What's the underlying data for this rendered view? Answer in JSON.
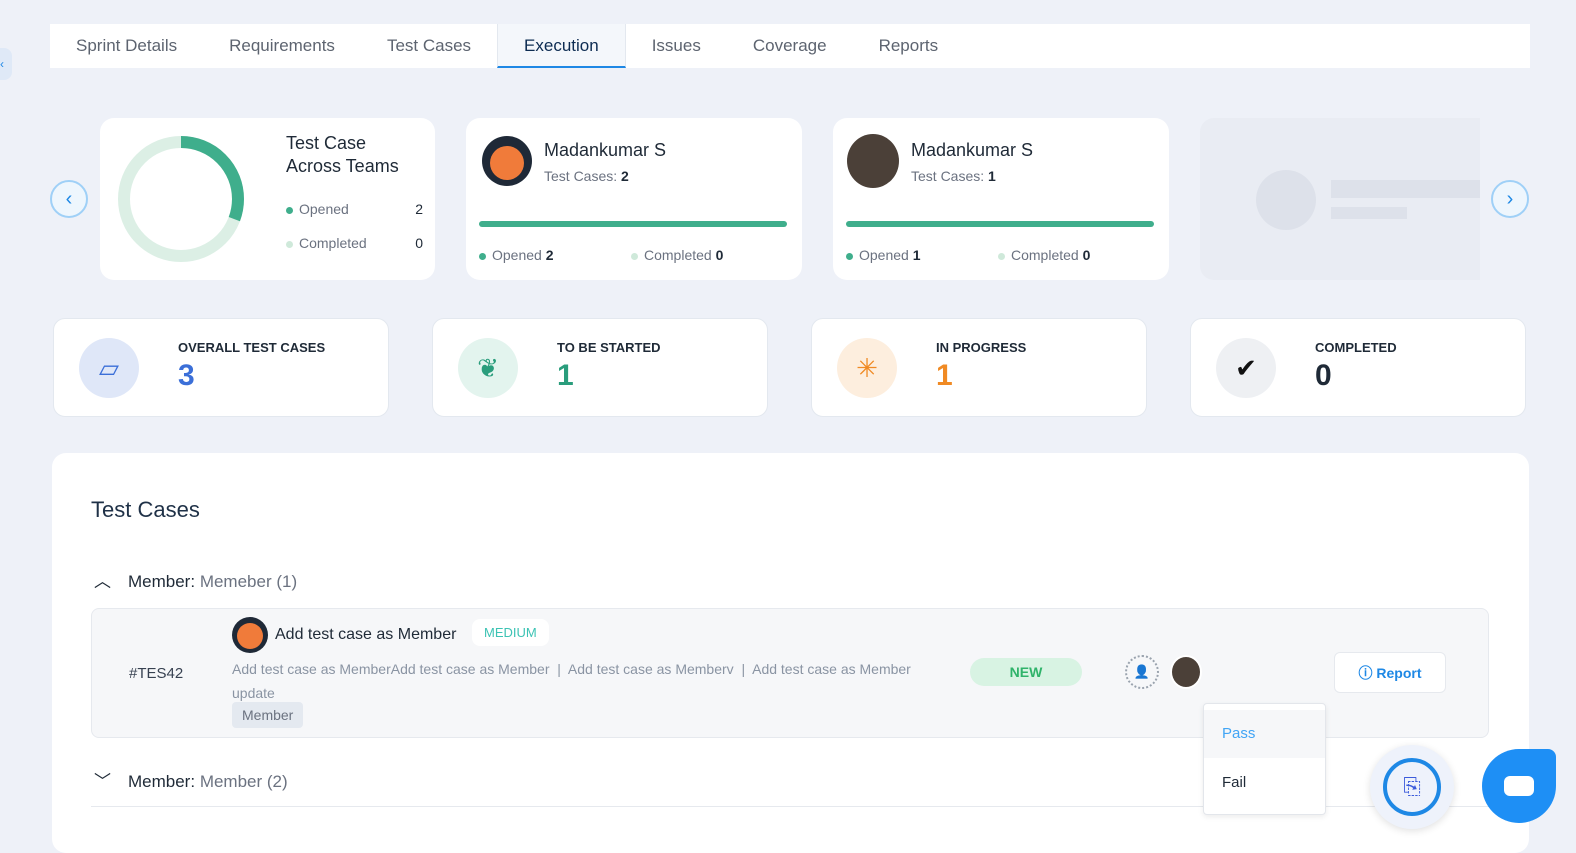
{
  "tabs": [
    "Sprint Details",
    "Requirements",
    "Test Cases",
    "Execution",
    "Issues",
    "Coverage",
    "Reports"
  ],
  "summary": {
    "title_line1": "Test Case",
    "title_line2": "Across Teams",
    "opened_label": "Opened",
    "opened": "2",
    "completed_label": "Completed",
    "completed": "0"
  },
  "members": [
    {
      "name": "Madankumar S",
      "cases_label": "Test Cases:",
      "cases": "2",
      "opened_label": "Opened",
      "opened": "2",
      "completed_label": "Completed",
      "completed": "0"
    },
    {
      "name": "Madankumar S",
      "cases_label": "Test Cases:",
      "cases": "1",
      "opened_label": "Opened",
      "opened": "1",
      "completed_label": "Completed",
      "completed": "0"
    }
  ],
  "stats": [
    {
      "label": "OVERALL TEST CASES",
      "value": "3",
      "color": "#3b6fd8"
    },
    {
      "label": "TO BE STARTED",
      "value": "1",
      "color": "#2a9d7c"
    },
    {
      "label": "IN PROGRESS",
      "value": "1",
      "color": "#f08a24"
    },
    {
      "label": "COMPLETED",
      "value": "0",
      "color": "#1f2a37"
    }
  ],
  "panel": {
    "title": "Test Cases",
    "groups": [
      {
        "prefix": "Member:",
        "name": "Memeber (1)"
      },
      {
        "prefix": "Member:",
        "name": "Member (2)"
      }
    ],
    "row": {
      "id": "#TES42",
      "title": "Add test case as Member",
      "priority": "MEDIUM",
      "desc1": "Add test case as MemberAdd test case as Member",
      "desc2": "Add test case as Memberv",
      "desc3": "Add test case as Member",
      "desc4": "update",
      "sep": "|",
      "tag": "Member",
      "status": "NEW",
      "report": "Report"
    },
    "dropdown": [
      "Pass",
      "Fail"
    ]
  }
}
